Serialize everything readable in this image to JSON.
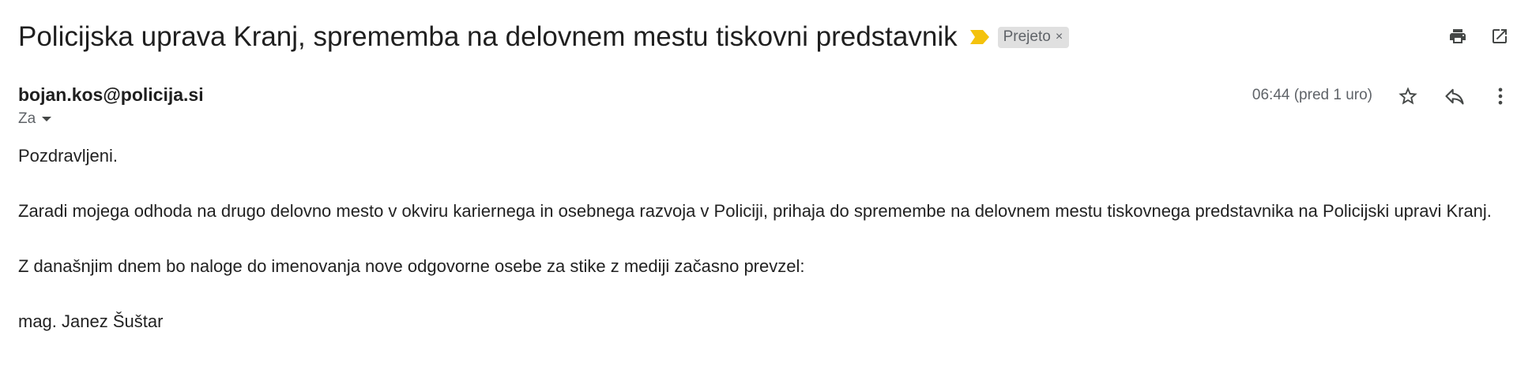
{
  "email": {
    "subject": "Policijska uprava Kranj, sprememba na delovnem mestu tiskovni predstavnik",
    "label": "Prejeto",
    "label_close": "×",
    "sender": "bojan.kos@policija.si",
    "recipients_label": "Za",
    "timestamp": "06:44 (pred 1 uro)",
    "body": {
      "greeting": "Pozdravljeni.",
      "paragraph1": "Zaradi mojega odhoda na drugo delovno mesto v okviru kariernega in osebnega razvoja v Policiji, prihaja do spremembe na delovnem mestu tiskovnega predstavnika na Policijski upravi Kranj.",
      "paragraph2": "Z današnjim dnem bo naloge do imenovanja nove odgovorne osebe za stike z mediji začasno prevzel:",
      "paragraph3": "mag. Janez Šuštar"
    }
  },
  "icons": {
    "importance": "importance-marker-icon",
    "print": "print-icon",
    "open_new_window": "open-in-new-window-icon",
    "star": "star-icon",
    "reply": "reply-icon",
    "more": "more-vert-icon"
  },
  "colors": {
    "importance_marker": "#f4c20d",
    "label_chip_bg": "#e0e0e0",
    "secondary_text": "#5f6368"
  }
}
